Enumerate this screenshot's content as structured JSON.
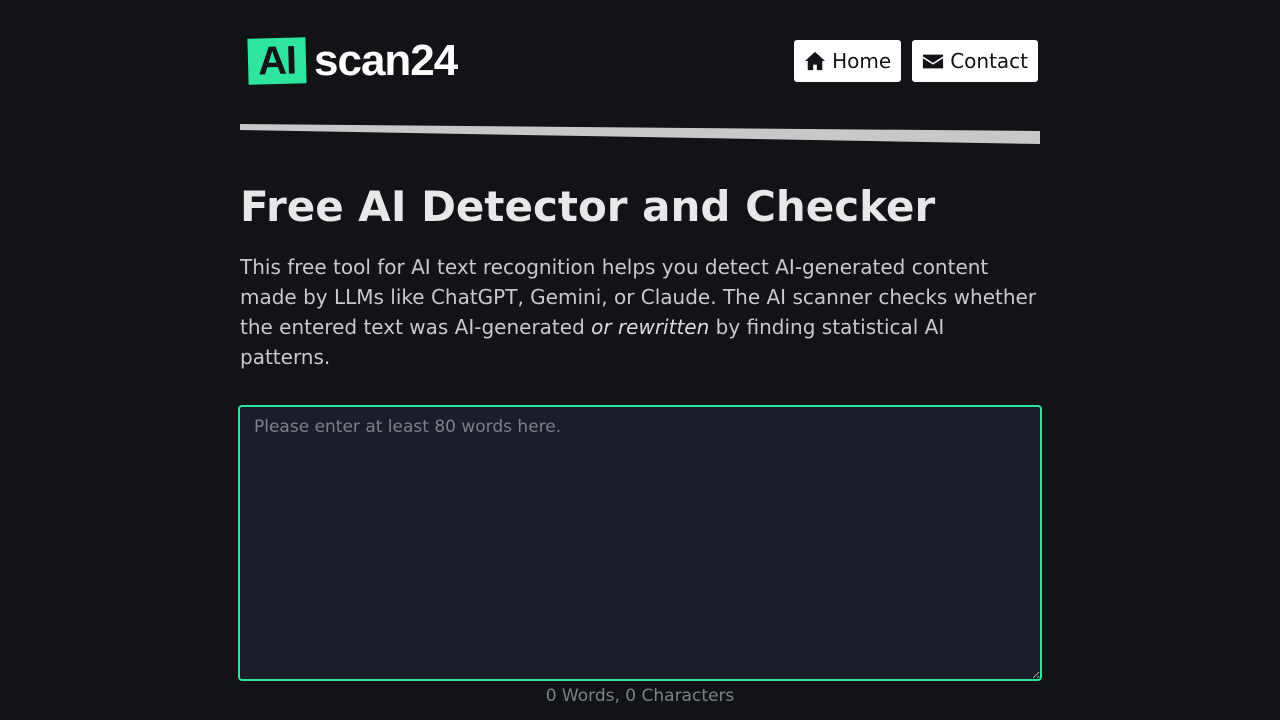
{
  "header": {
    "logo_mark": "AI",
    "logo_text": "scan24",
    "nav": {
      "home_label": "Home",
      "contact_label": "Contact"
    }
  },
  "main": {
    "title": "Free AI Detector and Checker",
    "intro_part1": "This free tool for AI text recognition helps you detect AI-generated content made by LLMs like ChatGPT, Gemini, or Claude. The AI scanner checks whether the entered text was AI-generated ",
    "intro_em": "or rewritten",
    "intro_part2": " by finding statistical AI patterns.",
    "input": {
      "placeholder": "Please enter at least 80 words here.",
      "value": ""
    },
    "counter": "0 Words, 0 Characters"
  },
  "colors": {
    "background": "#121317",
    "accent": "#2ee59d",
    "editor_background": "#1a1e29",
    "divider": "#c8c8c8"
  },
  "icons": [
    "home-icon",
    "envelope-icon"
  ]
}
